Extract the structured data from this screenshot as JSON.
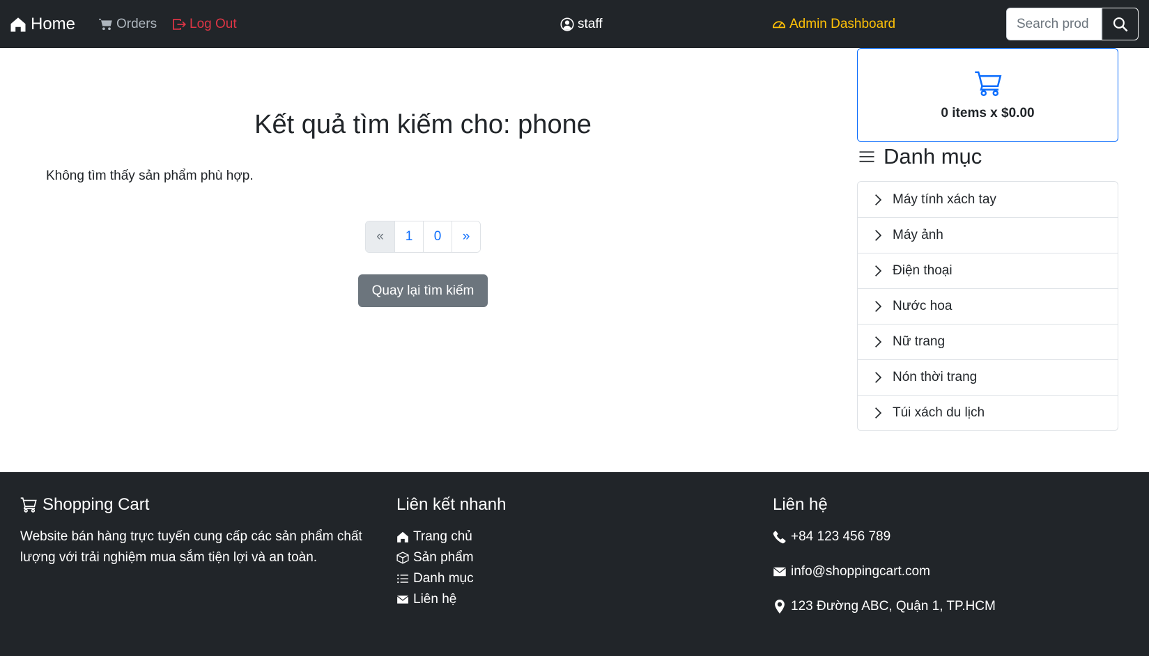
{
  "navbar": {
    "home_label": "Home",
    "orders_label": "Orders",
    "logout_label": "Log Out",
    "user_label": "staff",
    "admin_label": "Admin Dashboard",
    "search_placeholder": "Search prod"
  },
  "main": {
    "title": "Kết quả tìm kiếm cho: phone",
    "no_result": "Không tìm thấy sản phẩm phù hợp.",
    "pagination": [
      "«",
      "1",
      "0",
      "»"
    ],
    "back_button": "Quay lại tìm kiếm"
  },
  "sidebar": {
    "cart_summary": "0 items x $0.00",
    "categories_heading": "Danh mục",
    "categories": [
      "Máy tính xách tay",
      "Máy ảnh",
      "Điện thoại",
      "Nước hoa",
      "Nữ trang",
      "Nón thời trang",
      "Túi xách du lịch"
    ]
  },
  "footer": {
    "brand_heading": "Shopping Cart",
    "brand_description": "Website bán hàng trực tuyến cung cấp các sản phẩm chất lượng với trải nghiệm mua sắm tiện lợi và an toàn.",
    "links_heading": "Liên kết nhanh",
    "links": [
      "Trang chủ",
      "Sản phẩm",
      "Danh mục",
      "Liên hệ"
    ],
    "contact_heading": "Liên hệ",
    "phone": "+84 123 456 789",
    "email": "info@shoppingcart.com",
    "address": "123 Đường ABC, Quận 1, TP.HCM"
  },
  "colors": {
    "navbar_bg": "#212529",
    "primary": "#0d6efd",
    "danger": "#dc3545",
    "warning": "#ffc107",
    "secondary": "#6c757d"
  }
}
